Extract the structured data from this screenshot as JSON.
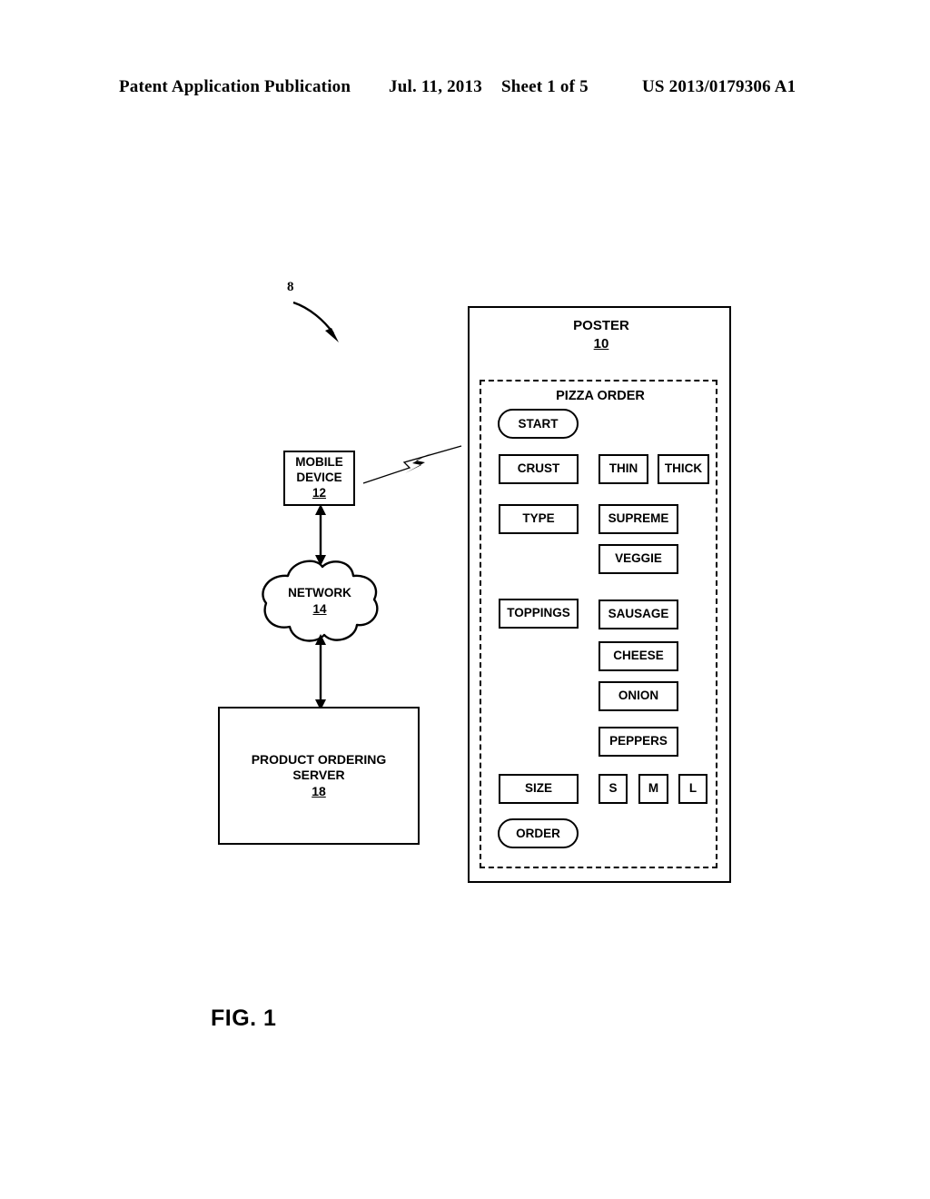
{
  "header": {
    "publication": "Patent Application Publication",
    "date": "Jul. 11, 2013",
    "sheet": "Sheet 1 of 5",
    "patent_number": "US 2013/0179306 A1"
  },
  "figure": {
    "caption": "FIG. 1",
    "system_ref": "8"
  },
  "nodes": {
    "mobile_device": {
      "line1": "MOBILE",
      "line2": "DEVICE",
      "ref": "12"
    },
    "network": {
      "label": "NETWORK",
      "ref": "14"
    },
    "product_ordering_server": {
      "line1": "PRODUCT ORDERING",
      "line2": "SERVER",
      "ref": "18"
    }
  },
  "poster": {
    "title": "POSTER",
    "ref": "10",
    "panel_title": "PIZZA ORDER",
    "controls": {
      "start": "START",
      "order": "ORDER",
      "crust_label": "CRUST",
      "crust_options": [
        "THIN",
        "THICK"
      ],
      "type_label": "TYPE",
      "type_options": [
        "SUPREME",
        "VEGGIE"
      ],
      "toppings_label": "TOPPINGS",
      "toppings_options": [
        "SAUSAGE",
        "CHEESE",
        "ONION",
        "PEPPERS"
      ],
      "size_label": "SIZE",
      "size_options": [
        "S",
        "M",
        "L"
      ]
    }
  },
  "colors": {
    "ink": "#000000",
    "paper": "#ffffff"
  }
}
